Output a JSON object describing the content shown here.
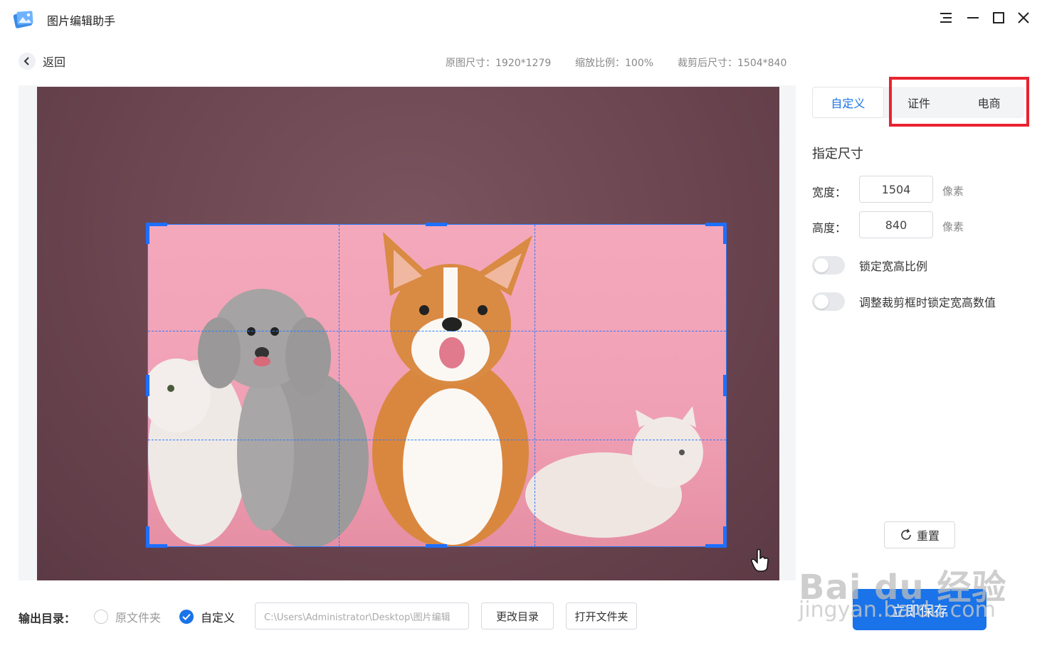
{
  "window": {
    "title": "图片编辑助手",
    "controls": [
      "menu-icon",
      "minimize-icon",
      "maximize-icon",
      "close-icon"
    ]
  },
  "nav": {
    "back_label": "返回"
  },
  "info": {
    "original_size": "原图尺寸：1920*1279",
    "zoom": "缩放比例：100%",
    "cropped_size": "裁剪后尺寸：1504*840"
  },
  "tabs": [
    {
      "label": "自定义",
      "active": true
    },
    {
      "label": "证件",
      "active": false
    },
    {
      "label": "电商",
      "active": false
    }
  ],
  "panel": {
    "section_title": "指定尺寸",
    "width_label": "宽度：",
    "width_value": "1504",
    "height_label": "高度：",
    "height_value": "840",
    "unit": "像素",
    "lock_ratio_label": "锁定宽高比例",
    "lock_values_label": "调整裁剪框时锁定宽高数值",
    "reset_label": "重置",
    "save_label": "立即保存"
  },
  "output": {
    "label": "输出目录：",
    "option_original": "原文件夹",
    "option_custom": "自定义",
    "path": "C:\\Users\\Administrator\\Desktop\\图片编辑",
    "change_dir": "更改目录",
    "open_folder": "打开文件夹"
  },
  "watermark": {
    "line1": "Bai du 经验",
    "line2": "jingyan.baidu.com"
  },
  "colors": {
    "accent": "#1a73e8",
    "highlight": "#e8232f",
    "crop_border": "#2b7bff"
  }
}
